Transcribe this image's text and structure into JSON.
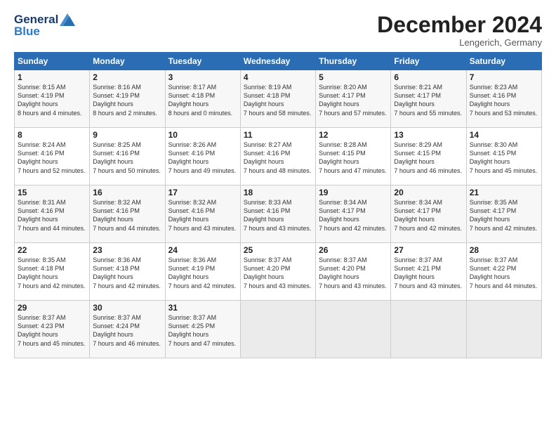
{
  "header": {
    "logo_line1": "General",
    "logo_line2": "Blue",
    "month": "December 2024",
    "location": "Lengerich, Germany"
  },
  "weekdays": [
    "Sunday",
    "Monday",
    "Tuesday",
    "Wednesday",
    "Thursday",
    "Friday",
    "Saturday"
  ],
  "weeks": [
    [
      {
        "day": "1",
        "sunrise": "8:15 AM",
        "sunset": "4:19 PM",
        "daylight": "8 hours and 4 minutes."
      },
      {
        "day": "2",
        "sunrise": "8:16 AM",
        "sunset": "4:19 PM",
        "daylight": "8 hours and 2 minutes."
      },
      {
        "day": "3",
        "sunrise": "8:17 AM",
        "sunset": "4:18 PM",
        "daylight": "8 hours and 0 minutes."
      },
      {
        "day": "4",
        "sunrise": "8:19 AM",
        "sunset": "4:18 PM",
        "daylight": "7 hours and 58 minutes."
      },
      {
        "day": "5",
        "sunrise": "8:20 AM",
        "sunset": "4:17 PM",
        "daylight": "7 hours and 57 minutes."
      },
      {
        "day": "6",
        "sunrise": "8:21 AM",
        "sunset": "4:17 PM",
        "daylight": "7 hours and 55 minutes."
      },
      {
        "day": "7",
        "sunrise": "8:23 AM",
        "sunset": "4:16 PM",
        "daylight": "7 hours and 53 minutes."
      }
    ],
    [
      {
        "day": "8",
        "sunrise": "8:24 AM",
        "sunset": "4:16 PM",
        "daylight": "7 hours and 52 minutes."
      },
      {
        "day": "9",
        "sunrise": "8:25 AM",
        "sunset": "4:16 PM",
        "daylight": "7 hours and 50 minutes."
      },
      {
        "day": "10",
        "sunrise": "8:26 AM",
        "sunset": "4:16 PM",
        "daylight": "7 hours and 49 minutes."
      },
      {
        "day": "11",
        "sunrise": "8:27 AM",
        "sunset": "4:16 PM",
        "daylight": "7 hours and 48 minutes."
      },
      {
        "day": "12",
        "sunrise": "8:28 AM",
        "sunset": "4:15 PM",
        "daylight": "7 hours and 47 minutes."
      },
      {
        "day": "13",
        "sunrise": "8:29 AM",
        "sunset": "4:15 PM",
        "daylight": "7 hours and 46 minutes."
      },
      {
        "day": "14",
        "sunrise": "8:30 AM",
        "sunset": "4:15 PM",
        "daylight": "7 hours and 45 minutes."
      }
    ],
    [
      {
        "day": "15",
        "sunrise": "8:31 AM",
        "sunset": "4:16 PM",
        "daylight": "7 hours and 44 minutes."
      },
      {
        "day": "16",
        "sunrise": "8:32 AM",
        "sunset": "4:16 PM",
        "daylight": "7 hours and 44 minutes."
      },
      {
        "day": "17",
        "sunrise": "8:32 AM",
        "sunset": "4:16 PM",
        "daylight": "7 hours and 43 minutes."
      },
      {
        "day": "18",
        "sunrise": "8:33 AM",
        "sunset": "4:16 PM",
        "daylight": "7 hours and 43 minutes."
      },
      {
        "day": "19",
        "sunrise": "8:34 AM",
        "sunset": "4:17 PM",
        "daylight": "7 hours and 42 minutes."
      },
      {
        "day": "20",
        "sunrise": "8:34 AM",
        "sunset": "4:17 PM",
        "daylight": "7 hours and 42 minutes."
      },
      {
        "day": "21",
        "sunrise": "8:35 AM",
        "sunset": "4:17 PM",
        "daylight": "7 hours and 42 minutes."
      }
    ],
    [
      {
        "day": "22",
        "sunrise": "8:35 AM",
        "sunset": "4:18 PM",
        "daylight": "7 hours and 42 minutes."
      },
      {
        "day": "23",
        "sunrise": "8:36 AM",
        "sunset": "4:18 PM",
        "daylight": "7 hours and 42 minutes."
      },
      {
        "day": "24",
        "sunrise": "8:36 AM",
        "sunset": "4:19 PM",
        "daylight": "7 hours and 42 minutes."
      },
      {
        "day": "25",
        "sunrise": "8:37 AM",
        "sunset": "4:20 PM",
        "daylight": "7 hours and 43 minutes."
      },
      {
        "day": "26",
        "sunrise": "8:37 AM",
        "sunset": "4:20 PM",
        "daylight": "7 hours and 43 minutes."
      },
      {
        "day": "27",
        "sunrise": "8:37 AM",
        "sunset": "4:21 PM",
        "daylight": "7 hours and 43 minutes."
      },
      {
        "day": "28",
        "sunrise": "8:37 AM",
        "sunset": "4:22 PM",
        "daylight": "7 hours and 44 minutes."
      }
    ],
    [
      {
        "day": "29",
        "sunrise": "8:37 AM",
        "sunset": "4:23 PM",
        "daylight": "7 hours and 45 minutes."
      },
      {
        "day": "30",
        "sunrise": "8:37 AM",
        "sunset": "4:24 PM",
        "daylight": "7 hours and 46 minutes."
      },
      {
        "day": "31",
        "sunrise": "8:37 AM",
        "sunset": "4:25 PM",
        "daylight": "7 hours and 47 minutes."
      },
      null,
      null,
      null,
      null
    ]
  ],
  "labels": {
    "sunrise": "Sunrise:",
    "sunset": "Sunset:",
    "daylight": "Daylight hours"
  }
}
